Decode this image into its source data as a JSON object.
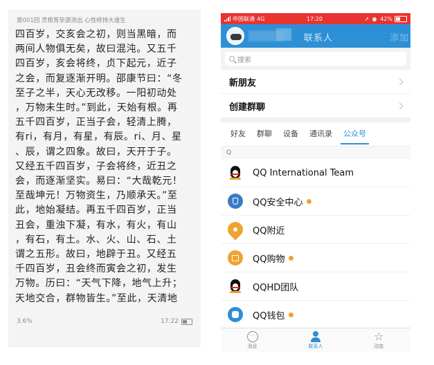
{
  "reader": {
    "header": "第001回 灵根育孕源流出 心性修持大道生",
    "lines": [
      "四百岁，交亥会之初，则当黑暗，而",
      "两间人物俱无矣，故曰混沌。又五千",
      "四百岁，亥会将终，贞下起元，近子",
      "之会，而复逐渐开明。邵康节曰：“冬",
      "至子之半，天心无改移。一阳初动处",
      "，万物未生时。”到此，天始有根。再",
      "五千四百岁，正当子会，轻清上腾，",
      "有ri，有月，有星，有辰。ri、月、星",
      "、辰，谓之四象。故曰，天开于子。",
      "又经五千四百岁，子会将终，近丑之",
      "会，而逐渐坚实。易曰：“大哉乾元！",
      "至哉坤元！万物资生，乃顺承天。”至",
      "此，地始凝结。再五千四百岁，正当",
      "丑会，重浊下凝，有水，有火，有山",
      "，有石，有土。水、火、山、石、土",
      "谓之五形。故曰，地辟于丑。又经五",
      "千四百岁，丑会终而寅会之初，发生",
      "万物。历曰：“天气下降，地气上升；",
      "天地交合，群物皆生。”至此，天清地"
    ],
    "progress": "3.6%",
    "time": "17:22"
  },
  "phone": {
    "status": {
      "carrier": "中国联通",
      "network": "4G",
      "time": "17:20",
      "battery": "42%"
    },
    "nav": {
      "title": "联系人",
      "add": "添加"
    },
    "search": {
      "placeholder": "搜索"
    },
    "rows": [
      {
        "label": "新朋友"
      },
      {
        "label": "创建群聊"
      }
    ],
    "tabs": [
      {
        "label": "好友"
      },
      {
        "label": "群聊"
      },
      {
        "label": "设备"
      },
      {
        "label": "通讯录"
      },
      {
        "label": "公众号"
      }
    ],
    "section_letter": "Q",
    "accounts": [
      {
        "name": "QQ International Team",
        "icon": "penguin-icon",
        "dot": false
      },
      {
        "name": "QQ安全中心",
        "icon": "shield-icon",
        "dot": true
      },
      {
        "name": "QQ附近",
        "icon": "location-pin-icon",
        "dot": false
      },
      {
        "name": "QQ购物",
        "icon": "shopping-bag-icon",
        "dot": true
      },
      {
        "name": "QQHD团队",
        "icon": "penguin-icon",
        "dot": false
      },
      {
        "name": "QQ钱包",
        "icon": "wallet-icon",
        "dot": true
      }
    ],
    "tabbar": [
      {
        "label": "消息"
      },
      {
        "label": "联系人"
      },
      {
        "label": "动态"
      }
    ],
    "colors": {
      "accent": "#2d8fd6",
      "status_bar": "#e8342f",
      "notify_dot": "#f0a231"
    }
  }
}
